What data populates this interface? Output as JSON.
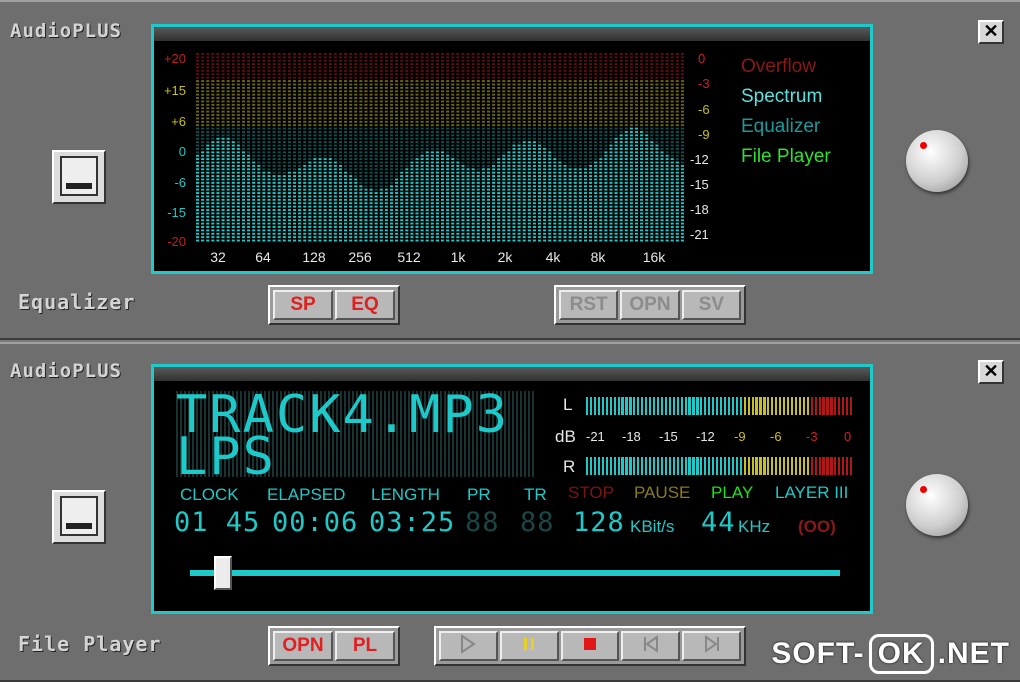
{
  "equalizer": {
    "app_title": "AudioPLUS",
    "panel_label": "Equalizer",
    "close_label": "✕",
    "left_ticks": [
      "+20",
      "+15",
      "+6",
      "0",
      "-6",
      "-15",
      "-20"
    ],
    "right_ticks": [
      "0",
      "-3",
      "-6",
      "-9",
      "-12",
      "-15",
      "-18",
      "-21"
    ],
    "freqs": [
      "32",
      "64",
      "128",
      "256",
      "512",
      "1k",
      "2k",
      "4k",
      "8k",
      "16k"
    ],
    "legend": {
      "overflow": "Overflow",
      "spectrum": "Spectrum",
      "equalizer": "Equalizer",
      "file_player": "File Player"
    },
    "buttons_left": [
      "SP",
      "EQ"
    ],
    "buttons_right": [
      "RST",
      "OPN",
      "SV"
    ]
  },
  "player": {
    "app_title": "AudioPLUS",
    "panel_label": "File Player",
    "close_label": "✕",
    "track_line1": "TRACK4.MP3",
    "track_line2": "LPS",
    "vu": {
      "left": "L",
      "right": "R",
      "db": "dB",
      "scale": [
        "-21",
        "-18",
        "-15",
        "-12",
        "-9",
        "-6",
        "-3",
        "0"
      ]
    },
    "labels": {
      "clock": "CLOCK",
      "elapsed": "ELAPSED",
      "length": "LENGTH",
      "pr": "PR",
      "tr": "TR",
      "stop": "STOP",
      "pause": "PAUSE",
      "play": "PLAY",
      "layer": "LAYER III"
    },
    "values": {
      "clock": "01 45",
      "elapsed": "00:06",
      "length": "03:25",
      "pr": "88",
      "tr": "88",
      "bitrate": "128",
      "bitrate_unit": "KBit/s",
      "freq": "44",
      "freq_unit": "KHz",
      "stereo": "(OO)"
    },
    "seek_position": 0.05,
    "buttons_left": [
      "OPN",
      "PL"
    ]
  },
  "watermark": {
    "left": "SOFT-",
    "mid": "OK",
    "right": ".NET"
  },
  "colors": {
    "accent": "#1ec9c9",
    "overflow": "#b01818",
    "warn": "#c8c020",
    "play": "#20e020"
  }
}
